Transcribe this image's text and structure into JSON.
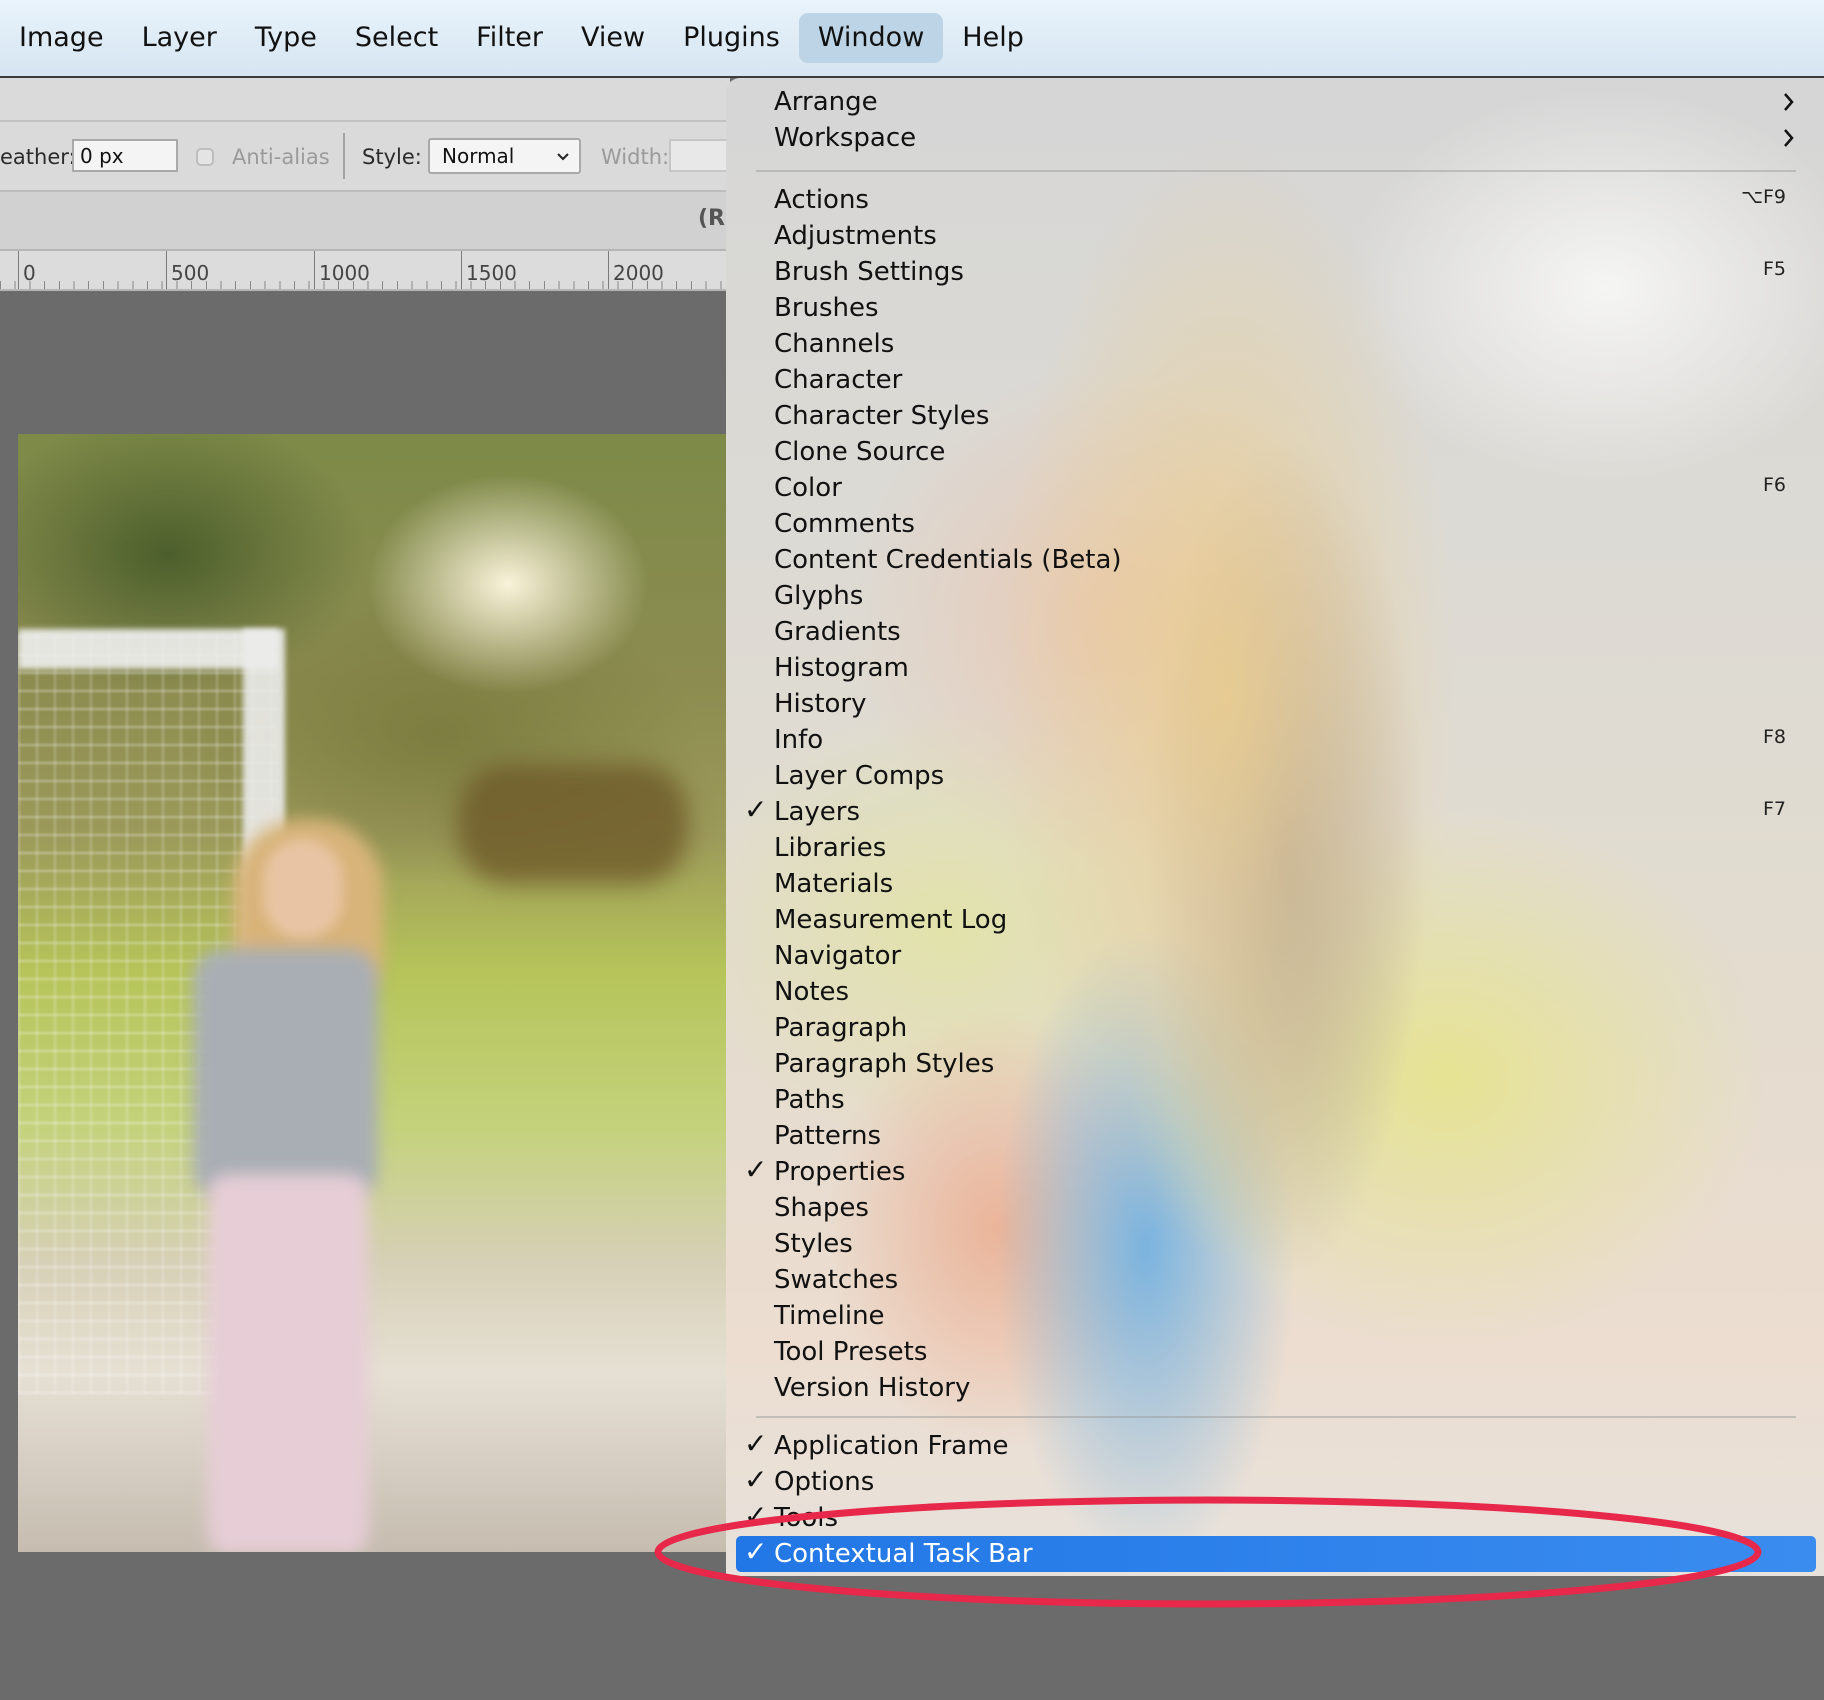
{
  "menubar": {
    "items": [
      {
        "label": "Image"
      },
      {
        "label": "Layer"
      },
      {
        "label": "Type"
      },
      {
        "label": "Select"
      },
      {
        "label": "Filter"
      },
      {
        "label": "View"
      },
      {
        "label": "Plugins"
      },
      {
        "label": "Window",
        "active": true
      },
      {
        "label": "Help"
      }
    ]
  },
  "options_bar": {
    "feather_label": "eather:",
    "feather_value": "0 px",
    "antialias_label": "Anti-alias",
    "antialias_checked": false,
    "style_label": "Style:",
    "style_value": "Normal",
    "width_label": "Width:"
  },
  "document_tab": {
    "label_fragment": "(R"
  },
  "ruler": {
    "labels": [
      "0",
      "500",
      "1000",
      "1500",
      "2000"
    ]
  },
  "window_menu": {
    "group1": [
      {
        "label": "Arrange",
        "submenu": true
      },
      {
        "label": "Workspace",
        "submenu": true
      }
    ],
    "group2": [
      {
        "label": "Actions",
        "shortcut": "⌥F9"
      },
      {
        "label": "Adjustments"
      },
      {
        "label": "Brush Settings",
        "shortcut": "F5"
      },
      {
        "label": "Brushes"
      },
      {
        "label": "Channels"
      },
      {
        "label": "Character"
      },
      {
        "label": "Character Styles"
      },
      {
        "label": "Clone Source"
      },
      {
        "label": "Color",
        "shortcut": "F6"
      },
      {
        "label": "Comments"
      },
      {
        "label": "Content Credentials (Beta)"
      },
      {
        "label": "Glyphs"
      },
      {
        "label": "Gradients"
      },
      {
        "label": "Histogram"
      },
      {
        "label": "History"
      },
      {
        "label": "Info",
        "shortcut": "F8"
      },
      {
        "label": "Layer Comps"
      },
      {
        "label": "Layers",
        "checked": true,
        "shortcut": "F7"
      },
      {
        "label": "Libraries"
      },
      {
        "label": "Materials"
      },
      {
        "label": "Measurement Log"
      },
      {
        "label": "Navigator"
      },
      {
        "label": "Notes"
      },
      {
        "label": "Paragraph"
      },
      {
        "label": "Paragraph Styles"
      },
      {
        "label": "Paths"
      },
      {
        "label": "Patterns"
      },
      {
        "label": "Properties",
        "checked": true
      },
      {
        "label": "Shapes"
      },
      {
        "label": "Styles"
      },
      {
        "label": "Swatches"
      },
      {
        "label": "Timeline"
      },
      {
        "label": "Tool Presets"
      },
      {
        "label": "Version History"
      }
    ],
    "group3": [
      {
        "label": "Application Frame",
        "checked": true
      },
      {
        "label": "Options",
        "checked": true
      },
      {
        "label": "Tools",
        "checked": true
      },
      {
        "label": "Contextual Task Bar",
        "checked": true,
        "highlighted": true
      }
    ],
    "check_glyph": "✓",
    "highlight_color": "#2b7ee8"
  },
  "annotation": {
    "shape": "ellipse",
    "color": "#e8284a",
    "target": "Contextual Task Bar"
  }
}
